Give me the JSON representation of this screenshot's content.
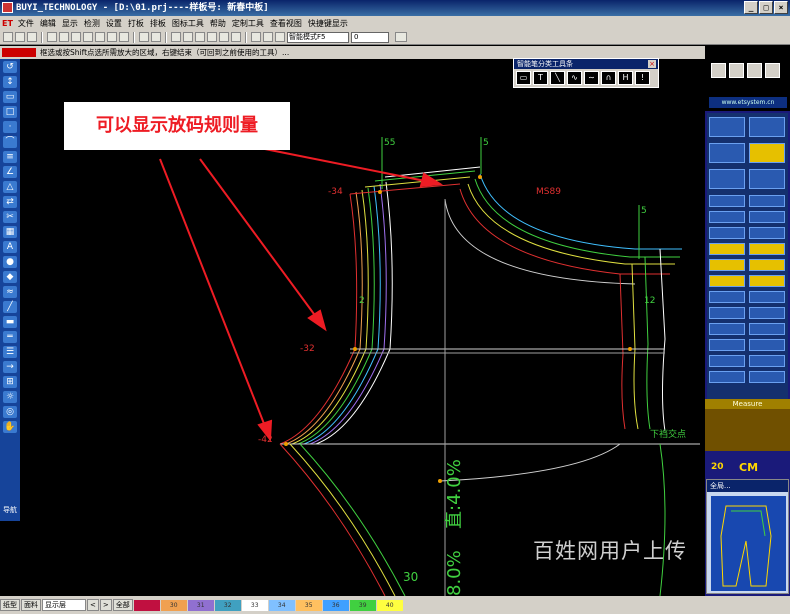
{
  "window": {
    "title": "BUYI_TECHNOLOGY - [D:\\01.prj----样板号: 新春中板]",
    "buttons": [
      "_",
      "□",
      "×"
    ]
  },
  "menu": {
    "logo": "ET",
    "items": [
      "文件",
      "编辑",
      "显示",
      "检测",
      "设置",
      "打板",
      "排板",
      "图标工具",
      "帮助",
      "定制工具",
      "查看视图",
      "快捷键显示"
    ]
  },
  "toolbar": {
    "mode_label": "智能模式F5",
    "value": "0"
  },
  "status": {
    "hint": "框选或按Shift点选所需放大的区域，右键结束（可回到之前使用的工具）..."
  },
  "callout": {
    "text": "可以显示放码规则量"
  },
  "smart_toolbar": {
    "title": "智能笔分类工具条",
    "icons": [
      "rect",
      "T",
      "\\",
      "~",
      "~",
      "∩",
      "H",
      "!"
    ]
  },
  "canvas_labels": {
    "top_left_55": "55",
    "top_right_5": "5",
    "minus34": "-34",
    "ms89": "MS89",
    "right_5": "5",
    "label_2": "2",
    "label_12": "12",
    "minus32": "-32",
    "minus42": "-42",
    "crosspoint": "下裆交点",
    "vertical_text_1": "直:4.0%",
    "vertical_text_2": "8.0%",
    "bottom_num": "30"
  },
  "right_panel": {
    "site": "www.etsystem.cn",
    "measure_label": "Measure",
    "cm_left": "20",
    "cm_right": "CM",
    "preview_title": "全局..."
  },
  "bottom": {
    "tab1": "纸型",
    "tab2": "面料",
    "sel": "显示层",
    "nav_prev": "<",
    "nav_next": ">",
    "all": "全部",
    "swatches": [
      {
        "label": "",
        "color": "#c01040"
      },
      {
        "label": "30",
        "color": "#f0a050"
      },
      {
        "label": "31",
        "color": "#9070d0"
      },
      {
        "label": "32",
        "color": "#40a0c0"
      },
      {
        "label": "33",
        "color": "#ffffff"
      },
      {
        "label": "34",
        "color": "#80c0ff"
      },
      {
        "label": "35",
        "color": "#ffc060"
      },
      {
        "label": "36",
        "color": "#40a0ff"
      },
      {
        "label": "39",
        "color": "#40d040"
      },
      {
        "label": "40",
        "color": "#ffff40"
      }
    ]
  },
  "watermark": "百姓网用户上传",
  "side_nav": "导航"
}
